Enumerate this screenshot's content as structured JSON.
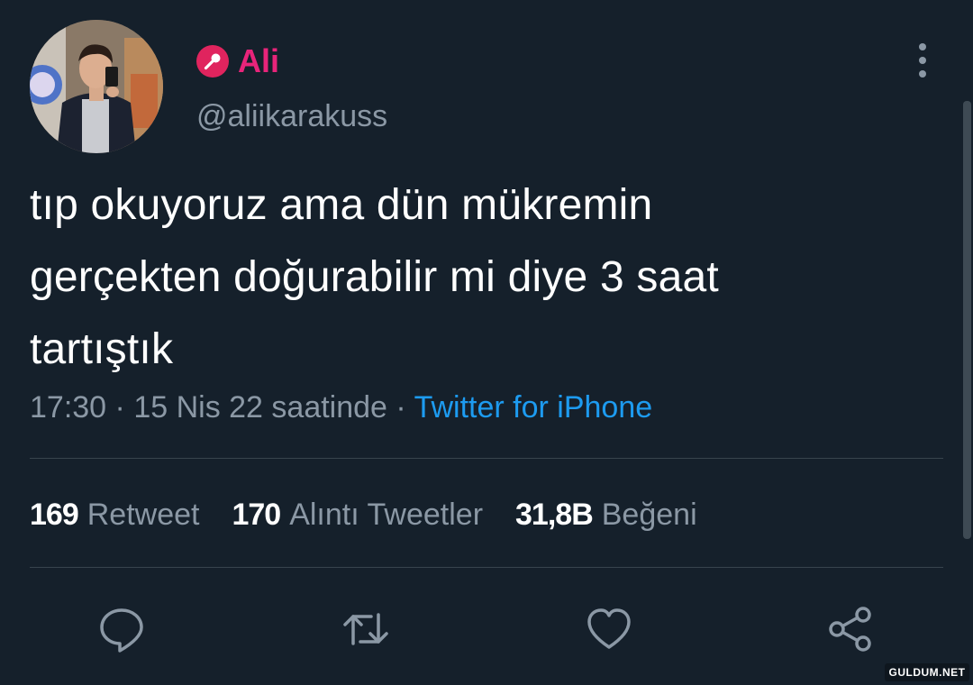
{
  "tweet": {
    "author": {
      "display_name": "Ali",
      "handle": "@aliikarakuss",
      "badge_icon": "microphone-icon",
      "name_color": "#e8247a"
    },
    "text_lines": [
      "tıp okuyoruz ama dün mükremin",
      "gerçekten doğurabilir mi diye 3 saat",
      "tartıştık"
    ],
    "meta": {
      "time": "17:30",
      "separator": "·",
      "date": "15 Nis 22 saatinde",
      "source": "Twitter for iPhone"
    },
    "stats": [
      {
        "count": "169",
        "label": "Retweet"
      },
      {
        "count": "170",
        "label": "Alıntı Tweetler"
      },
      {
        "count": "31,8B",
        "label": "Beğeni"
      }
    ],
    "actions": [
      {
        "icon": "reply-icon"
      },
      {
        "icon": "retweet-icon"
      },
      {
        "icon": "like-icon"
      },
      {
        "icon": "share-icon"
      }
    ]
  },
  "watermark": "GULDUM.NET",
  "colors": {
    "background": "#15202b",
    "secondary_text": "#8b98a5",
    "link": "#1d9bf0",
    "divider": "#38444d"
  }
}
